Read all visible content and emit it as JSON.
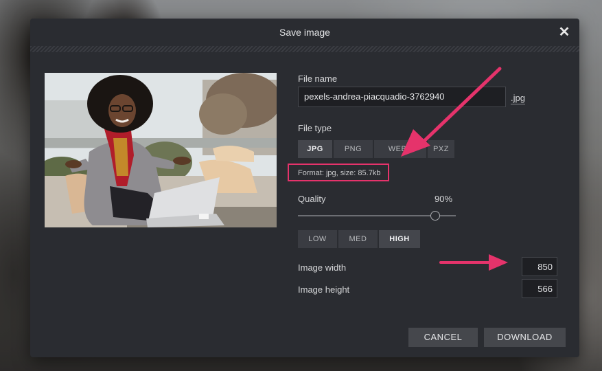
{
  "dialog": {
    "title": "Save image",
    "close_icon": "close-icon"
  },
  "file_name": {
    "label": "File name",
    "value": "pexels-andrea-piacquadio-3762940",
    "extension": ".jpg"
  },
  "file_type": {
    "label": "File type",
    "options": [
      "JPG",
      "PNG",
      "WEBP",
      "PXZ"
    ],
    "selected": "JPG"
  },
  "format_info": "Format: jpg, size: 85.7kb",
  "quality": {
    "label": "Quality",
    "value_text": "90%",
    "value": 0.9,
    "presets": [
      "LOW",
      "MED",
      "HIGH"
    ],
    "selected_preset": "HIGH"
  },
  "dimensions": {
    "width_label": "Image width",
    "width": "850",
    "height_label": "Image height",
    "height": "566"
  },
  "buttons": {
    "cancel": "CANCEL",
    "download": "DOWNLOAD"
  },
  "colors": {
    "dialog_bg": "#2a2c31",
    "annotation": "#e5336b"
  }
}
